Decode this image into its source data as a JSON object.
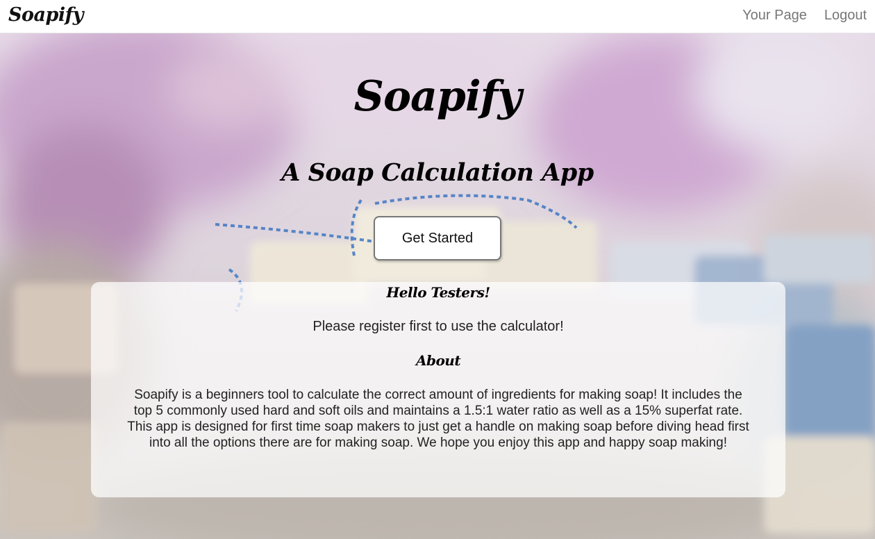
{
  "navbar": {
    "brand": "Soapify",
    "links": [
      "Your Page",
      "Logout"
    ]
  },
  "hero": {
    "title": "Soapify",
    "subtitle": "A Soap Calculation App",
    "cta_label": "Get Started"
  },
  "panel": {
    "greeting_heading": "Hello Testers!",
    "register_text": "Please register first to use the calculator!",
    "about_heading": "About",
    "about_text": "Soapify is a beginners tool to calculate the correct amount of ingredients for making soap! It includes the top 5 commonly used hard and soft oils and maintains a 1.5:1 water ratio as well as a 15% superfat rate. This app is designed for first time soap makers to just get a handle on making soap before diving head first into all the options there are for making soap. We hope you enjoy this app and happy soap making!"
  },
  "colors": {
    "navbar_bg": "#ffffff",
    "nav_link": "#777777",
    "panel_bg": "#ffffffb8",
    "button_border": "#777777"
  }
}
